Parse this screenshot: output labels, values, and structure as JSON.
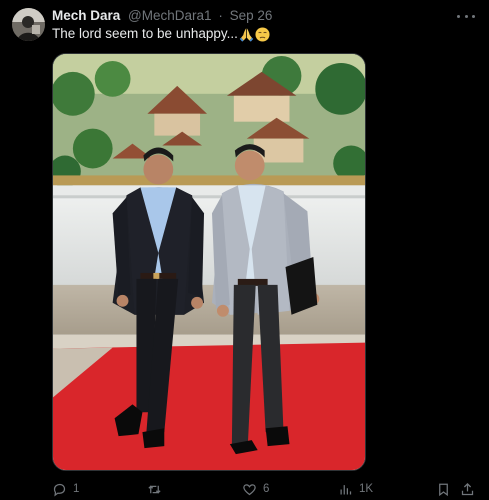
{
  "tweet": {
    "author": {
      "name": "Mech Dara",
      "handle": "@MechDara1",
      "separator": "·",
      "date": "Sep 26"
    },
    "text": "The lord seem to be unhappy...",
    "emojis": [
      "folded-hands",
      "unamused-face"
    ],
    "media": {
      "type": "photo"
    },
    "actions": {
      "replies": "1",
      "retweets": "",
      "likes": "6",
      "views": "1K"
    }
  },
  "colors": {
    "background": "#000000",
    "primary_text": "#e7e9ea",
    "secondary_text": "#71767b",
    "border": "#2f3336",
    "carpet": "#d9262b"
  }
}
